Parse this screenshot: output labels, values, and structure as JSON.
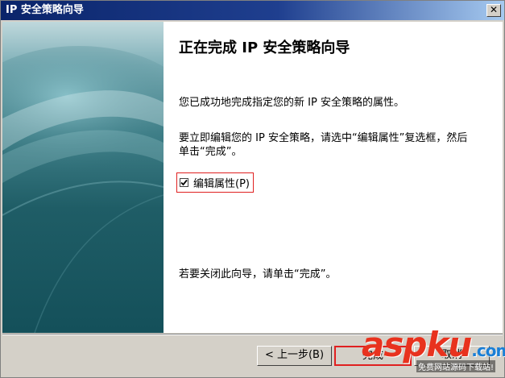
{
  "window": {
    "title": "IP 安全策略向导",
    "close_glyph": "✕"
  },
  "content": {
    "heading": "正在完成 IP 安全策略向导",
    "paragraph1": "您已成功地完成指定您的新 IP 安全策略的属性。",
    "paragraph2": "要立即编辑您的 IP 安全策略，请选中“编辑属性”复选框，然后单击“完成”。",
    "checkbox": {
      "label": "编辑属性(P)",
      "checked": true
    },
    "paragraph3": "若要关闭此向导，请单击“完成”。"
  },
  "buttons": {
    "back": "< 上一步(B)",
    "finish": "完成",
    "cancel": "取消"
  },
  "watermark": {
    "logo_main": "aspku",
    "logo_tld": ".com",
    "subtitle": "免费网站源码下载站!"
  },
  "colors": {
    "titlebar_start": "#0a246a",
    "titlebar_end": "#a6caf0",
    "highlight_border": "#e02020",
    "panel_teal": "#1f5d66"
  }
}
